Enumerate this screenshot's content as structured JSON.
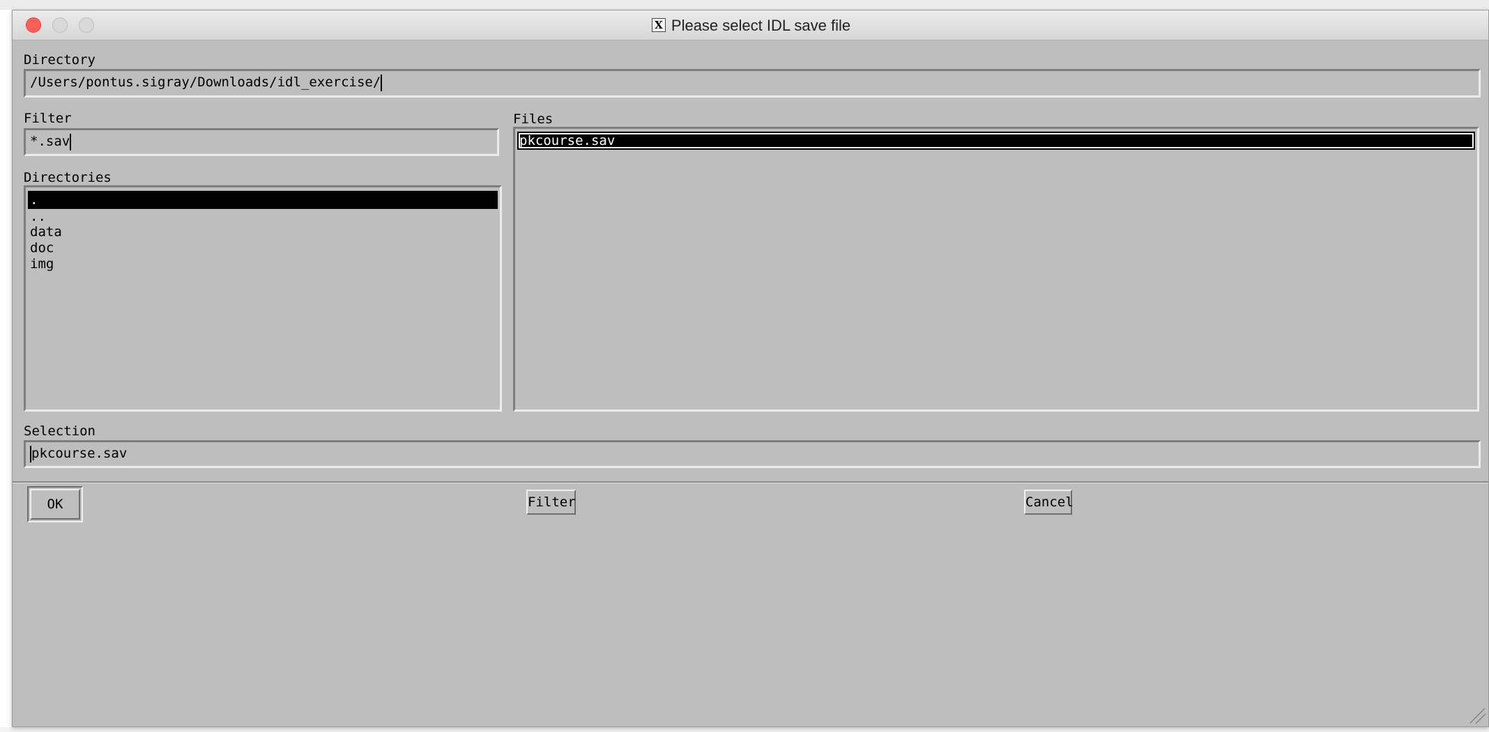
{
  "window": {
    "title": "Please select IDL save file",
    "title_icon": "X"
  },
  "directory": {
    "label": "Directory",
    "value": "/Users/pontus.sigray/Downloads/idl_exercise/"
  },
  "filter": {
    "label": "Filter",
    "value": "*.sav"
  },
  "directories": {
    "label": "Directories",
    "items": [
      ".",
      "..",
      "data",
      "doc",
      "img"
    ],
    "selected_index": 0
  },
  "files": {
    "label": "Files",
    "items": [
      "pkcourse.sav"
    ],
    "selected_index": 0
  },
  "selection": {
    "label": "Selection",
    "value": "pkcourse.sav"
  },
  "buttons": {
    "ok": "OK",
    "filter": "Filter",
    "cancel": "Cancel"
  },
  "colors": {
    "window_bg": "#bebebe",
    "close_button": "#fd5f57",
    "selection_bg": "#000000",
    "selection_fg": "#ffffff"
  },
  "icons": {
    "title_icon": "x11-icon",
    "resize": "resize-grip-icon"
  }
}
